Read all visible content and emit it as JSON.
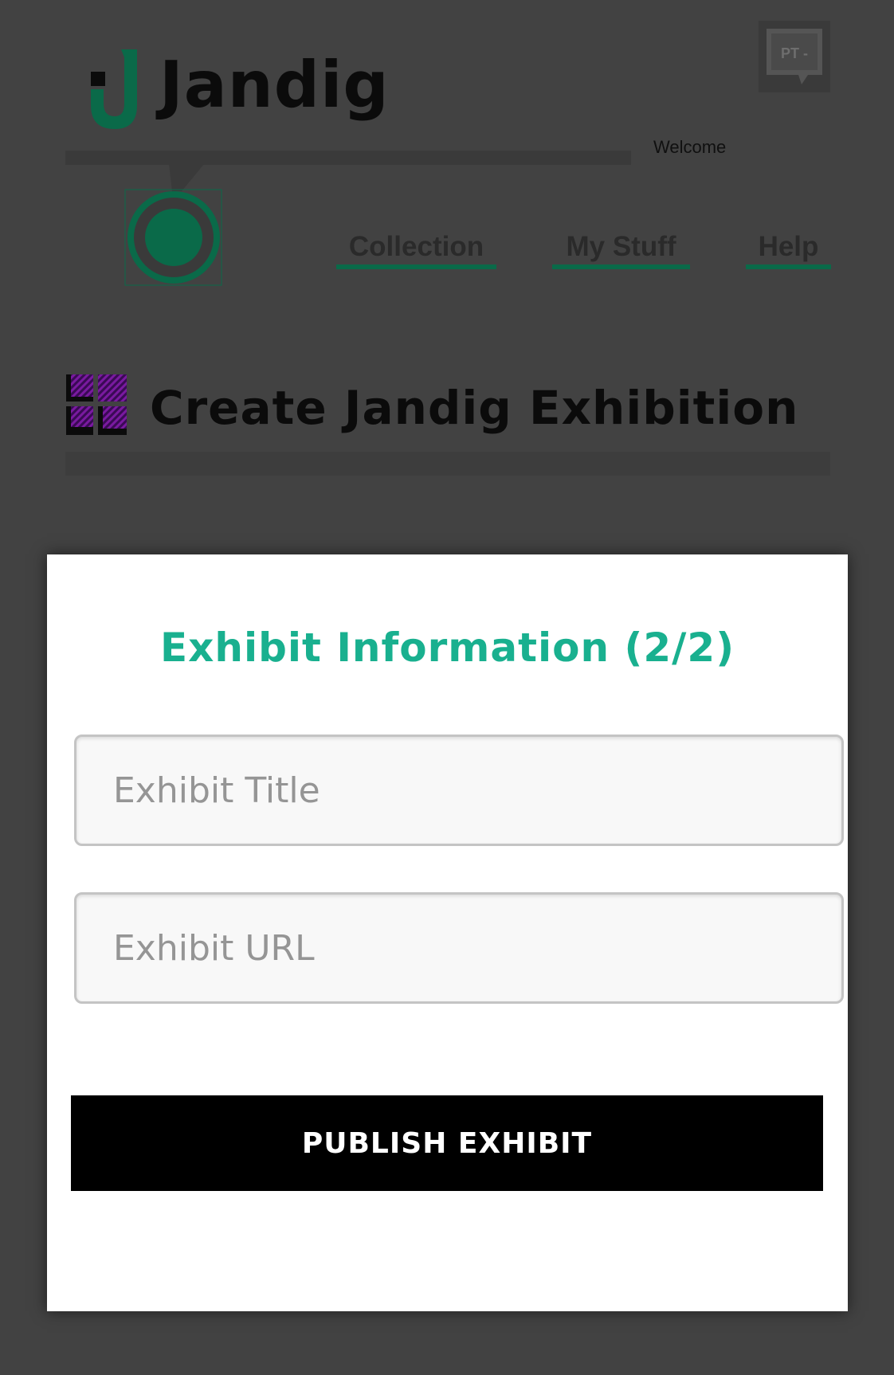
{
  "header": {
    "logo_text": "Jandig",
    "language_button": "PT -",
    "welcome_text": "Welcome"
  },
  "nav": {
    "items": [
      {
        "label": "Collection"
      },
      {
        "label": "My Stuff"
      },
      {
        "label": "Help"
      }
    ]
  },
  "page": {
    "title": "Create Jandig Exhibition"
  },
  "modal": {
    "title": "Exhibit Information (2/2)",
    "title_placeholder": "Exhibit Title",
    "url_placeholder": "Exhibit URL",
    "publish_label": "PUBLISH EXHIBIT"
  },
  "colors": {
    "background": "#424242",
    "brand_green": "#0a6a49",
    "accent_teal": "#19b08f",
    "icon_purple": "#4a0a6a"
  },
  "icons": {
    "logo": "jandig-logo-icon",
    "language": "speech-bubble-icon",
    "avatar": "user-avatar-icon",
    "exhibition": "grid-squares-icon"
  }
}
